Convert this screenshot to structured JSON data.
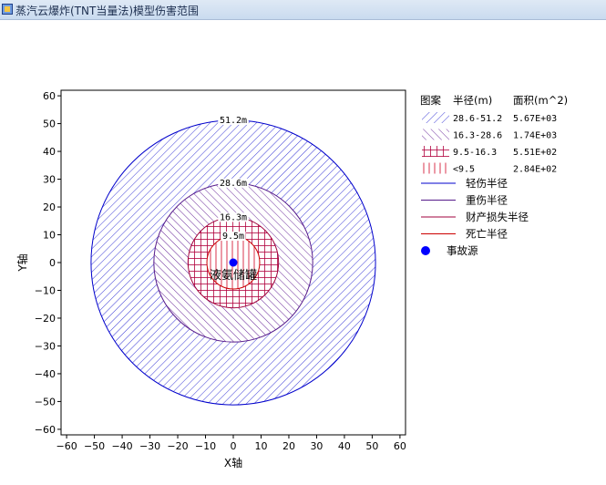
{
  "window": {
    "title": "蒸汽云爆炸(TNT当量法)模型伤害范围"
  },
  "chart_data": {
    "type": "area",
    "xlabel": "X轴",
    "ylabel": "Y轴",
    "xlim": [
      -62,
      62
    ],
    "ylim": [
      -62,
      62
    ],
    "ticks": [
      -60,
      -50,
      -40,
      -30,
      -20,
      -10,
      0,
      10,
      20,
      30,
      40,
      50,
      60
    ],
    "grid": false,
    "legend_position": "right",
    "center": [
      0,
      0
    ],
    "circles": [
      {
        "radius": 51.2,
        "label": "51.2m",
        "color": "#0000cc",
        "hatch": "forward"
      },
      {
        "radius": 28.6,
        "label": "28.6m",
        "color": "#551a8b",
        "hatch": "back"
      },
      {
        "radius": 16.3,
        "label": "16.3m",
        "color": "#a0003c",
        "hatch": "grid"
      },
      {
        "radius": 9.5,
        "label": "9.5m",
        "color": "#cc0000",
        "hatch": "vertical"
      }
    ],
    "annotation": "液氨储罐",
    "legend": {
      "headers": [
        "图案",
        "半径(m)",
        "面积(m^2)"
      ],
      "rows": [
        {
          "range": "28.6-51.2",
          "area": "5.67E+03",
          "color": "#3a3ad6",
          "hatch": "forward"
        },
        {
          "range": "16.3-28.6",
          "area": "1.74E+03",
          "color": "#6a2a9a",
          "hatch": "back"
        },
        {
          "range": "9.5-16.3",
          "area": "5.51E+02",
          "color": "#b0003c",
          "hatch": "grid"
        },
        {
          "range": "<9.5",
          "area": "2.84E+02",
          "color": "#d00020",
          "hatch": "vertical"
        }
      ],
      "lines": [
        {
          "label": "轻伤半径",
          "color": "#0000cc"
        },
        {
          "label": "重伤半径",
          "color": "#551a8b"
        },
        {
          "label": "财产损失半径",
          "color": "#a0003c"
        },
        {
          "label": "死亡半径",
          "color": "#cc0000"
        }
      ],
      "source": {
        "label": "事故源",
        "color": "#0000ff"
      }
    }
  }
}
